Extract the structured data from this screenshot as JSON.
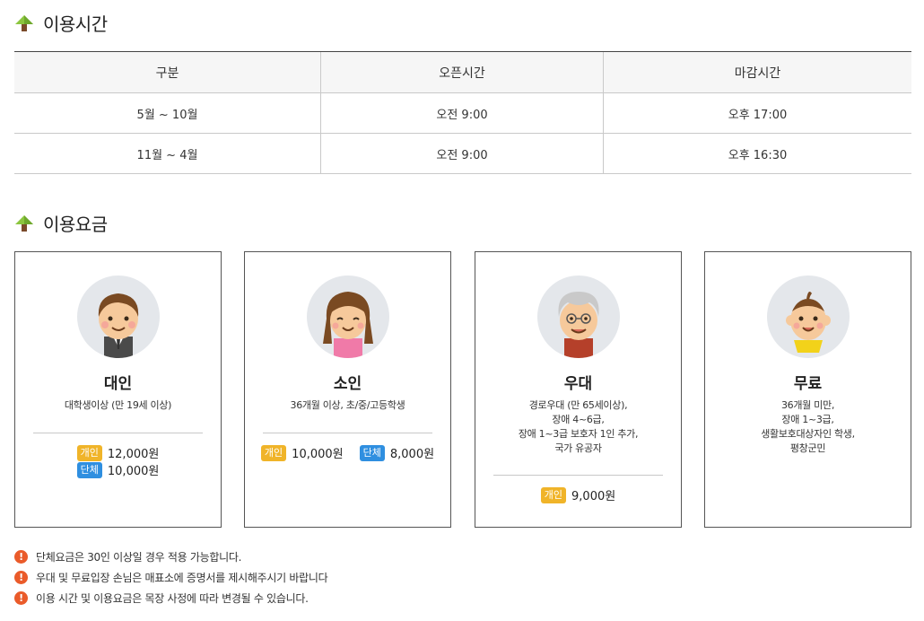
{
  "hours_section": {
    "title": "이용시간",
    "headers": [
      "구분",
      "오픈시간",
      "마감시간"
    ],
    "rows": [
      [
        "5월 ~ 10월",
        "오전 9:00",
        "오후 17:00"
      ],
      [
        "11월 ~ 4월",
        "오전 9:00",
        "오후 16:30"
      ]
    ]
  },
  "fee_section": {
    "title": "이용요금",
    "cards": [
      {
        "name": "대인",
        "desc": [
          "대학생이상 (만 19세 이상)"
        ],
        "prices": [
          {
            "badge": "개인",
            "amount": "12,000원"
          },
          {
            "badge": "단체",
            "amount": "10,000원"
          }
        ]
      },
      {
        "name": "소인",
        "desc": [
          "36개월 이상, 초/중/고등학생"
        ],
        "prices": [
          {
            "badge": "개인",
            "amount": "10,000원"
          },
          {
            "badge": "단체",
            "amount": "8,000원"
          }
        ]
      },
      {
        "name": "우대",
        "desc": [
          "경로우대 (만 65세이상),",
          "장애 4~6급,",
          "장애 1~3급 보호자 1인 추가,",
          "국가 유공자"
        ],
        "prices": [
          {
            "badge": "개인",
            "amount": "9,000원"
          }
        ]
      },
      {
        "name": "무료",
        "desc": [
          "36개월 미만,",
          "장애 1~3급,",
          "생활보호대상자인 학생,",
          "평창군민"
        ],
        "prices": []
      }
    ]
  },
  "notes": [
    "단체요금은 30인 이상일 경우 적용 가능합니다.",
    "우대 및 무료입장 손님은 매표소에 증명서를 제시해주시기 바랍니다",
    "이용 시간 및 이용요금은 목장 사정에 따라 변경될 수 있습니다."
  ],
  "colors": {
    "accent_green": "#8cc63f",
    "arrow_stem": "#7a4a2a",
    "badge_individual": "#f0b429",
    "badge_group": "#2f8fe0",
    "warning": "#ea5b2a"
  },
  "icons": {
    "section": "green-arrow-icon",
    "note": "warning-icon"
  }
}
